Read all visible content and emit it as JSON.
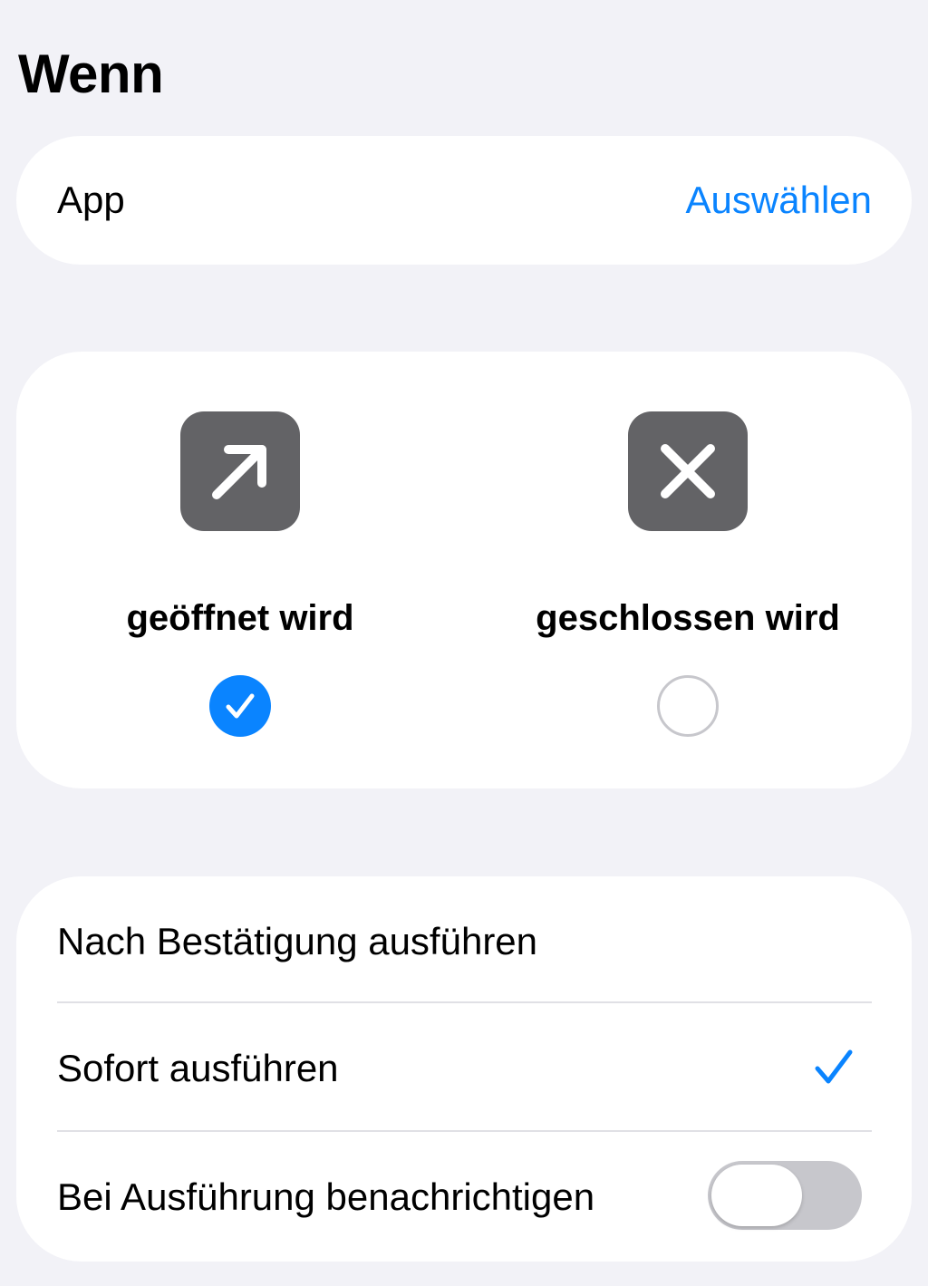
{
  "header": {
    "title": "Wenn"
  },
  "app_row": {
    "label": "App",
    "action_label": "Auswählen"
  },
  "trigger": {
    "options": [
      {
        "label": "geöffnet wird",
        "icon": "arrow-up-right-icon",
        "selected": true
      },
      {
        "label": "geschlossen wird",
        "icon": "xmark-icon",
        "selected": false
      }
    ]
  },
  "run_options": {
    "confirm_label": "Nach Bestätigung ausführen",
    "immediate_label": "Sofort ausführen",
    "immediate_selected": true,
    "notify_label": "Bei Ausführung benachrichtigen",
    "notify_enabled": false
  },
  "colors": {
    "accent": "#0a84ff",
    "background": "#f2f2f7",
    "tile": "#636366",
    "toggle_off": "#c7c7cc"
  }
}
